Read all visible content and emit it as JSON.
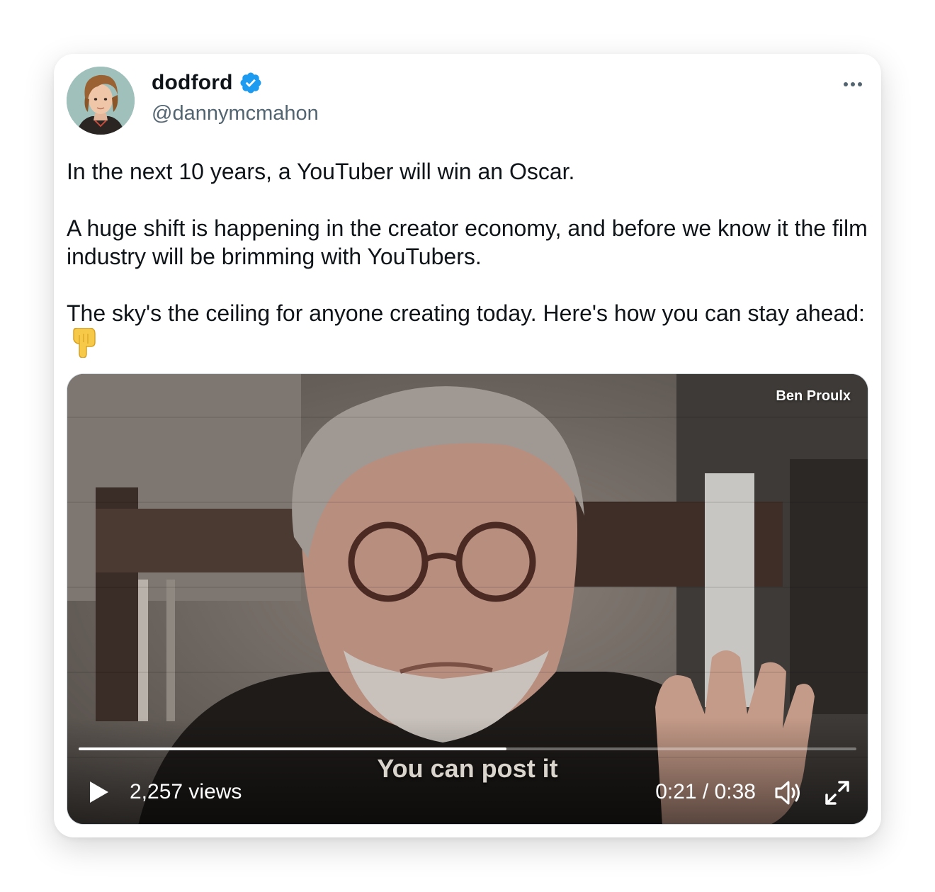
{
  "author": {
    "display_name": "dodford",
    "handle": "@dannymcmahon",
    "verified": true
  },
  "icons": {
    "avatar": "avatar-image",
    "verified": "verified-badge-icon",
    "more": "more-options-icon",
    "emoji": "backhand-index-pointing-down-emoji",
    "play": "play-icon",
    "volume": "volume-icon",
    "fullscreen": "fullscreen-icon"
  },
  "tweet": {
    "paragraphs": [
      "In the next 10 years, a YouTuber will win an Oscar.",
      "A huge shift is happening in the creator economy, and before we know it the film industry will be brimming with YouTubers.",
      "The sky's the ceiling for anyone creating today. Here's how you can stay ahead:"
    ]
  },
  "video": {
    "watermark": "Ben Proulx",
    "caption": "You can post it",
    "views": "2,257 views",
    "time": "0:21 / 0:38",
    "progress": 0.55
  },
  "colors": {
    "text_primary": "#0f1419",
    "text_secondary": "#536471",
    "verified_blue": "#1d9bf0"
  }
}
